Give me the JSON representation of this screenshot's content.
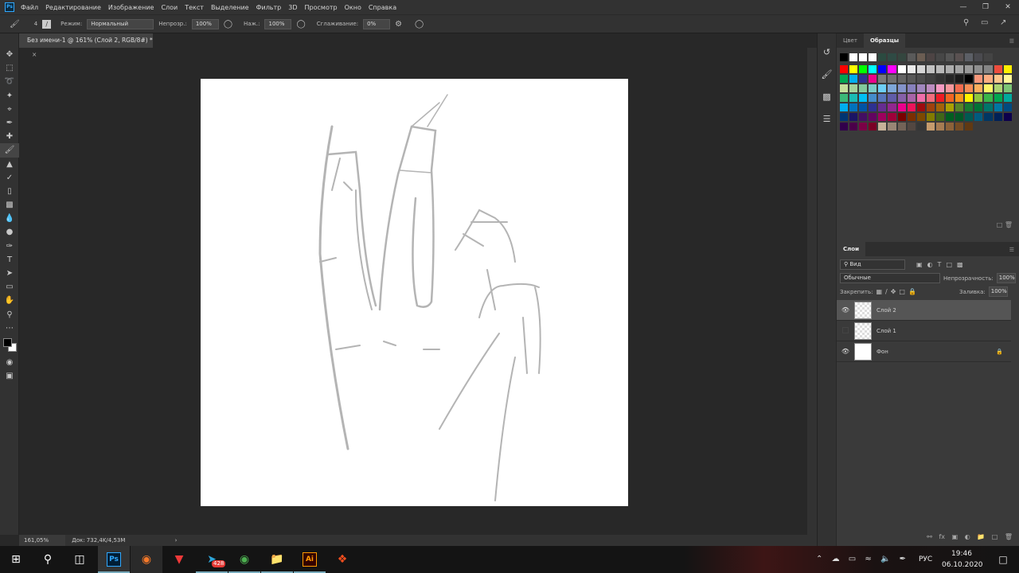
{
  "app": {
    "logo": "Ps",
    "menu": [
      "Файл",
      "Редактирование",
      "Изображение",
      "Слои",
      "Текст",
      "Выделение",
      "Фильтр",
      "3D",
      "Просмотр",
      "Окно",
      "Справка"
    ]
  },
  "options": {
    "brush_size": "4",
    "mode_label": "Режим:",
    "mode_value": "Нормальный",
    "opacity_label": "Непрозр.:",
    "opacity_value": "100%",
    "pressure_label": "Наж.:",
    "pressure_value": "100%",
    "smoothing_label": "Сглаживание:",
    "smoothing_value": "0%"
  },
  "document": {
    "tab_title": "Без имени-1 @ 161% (Слой 2, RGB/8#) *",
    "close": "×"
  },
  "status": {
    "zoom": "161,05%",
    "doc": "Док: 732,4K/4,53M",
    "arrow": "›"
  },
  "swatches_panel": {
    "tabs": [
      "Цвет",
      "Образцы"
    ],
    "active_tab": "Образцы",
    "rows": [
      [
        "#000000",
        "#ffffff",
        "#ffffff",
        "#ffffff",
        "#2b4a40",
        "#2f4a44",
        "#34463f",
        "#5a5a5a",
        "#6b5d52",
        "#4d4444",
        "#474747",
        "#555555",
        "#5a5151",
        "#5c5f66",
        "#4a4a4f",
        "#444444"
      ],
      [
        "#ff0000",
        "#ffff00",
        "#00ff00",
        "#00ffff",
        "#0000ff",
        "#ff00ff",
        "#ffffff",
        "#ebebeb",
        "#d6d6d6",
        "#c2c2c2",
        "#b8b8b8",
        "#adadad",
        "#a3a3a3",
        "#999999",
        "#8f8f8f",
        "#858585",
        "#ee4d3d",
        "#ffee00"
      ],
      [
        "#00a651",
        "#00aeef",
        "#2e3192",
        "#ec008c",
        "#7a7a7a",
        "#6f6f6f",
        "#646464",
        "#585858",
        "#4d4d4d",
        "#404040",
        "#333333",
        "#262626",
        "#1a1a1a",
        "#000000",
        "#f7977a",
        "#fbad82",
        "#fdc68c",
        "#fff799"
      ],
      [
        "#c4df9b",
        "#a3d39c",
        "#82ca9c",
        "#7accc8",
        "#6dcff6",
        "#7da7d9",
        "#8393ca",
        "#8781bd",
        "#a187be",
        "#bc8cbf",
        "#f49ac1",
        "#f6989d",
        "#f26c4f",
        "#f68e56",
        "#fbaf5d",
        "#fff568",
        "#acd373",
        "#7cc576"
      ],
      [
        "#3bb878",
        "#1abbb4",
        "#00bff3",
        "#448ccb",
        "#5674b9",
        "#605ca8",
        "#8560a8",
        "#a864a8",
        "#f06ea9",
        "#f26d7d",
        "#ed1c24",
        "#f26522",
        "#f7941d",
        "#fff200",
        "#8dc63f",
        "#39b54a",
        "#00a651",
        "#00a99d"
      ],
      [
        "#00aeef",
        "#0072bc",
        "#0054a6",
        "#2e3192",
        "#662d91",
        "#92278f",
        "#ec008c",
        "#ed145b",
        "#9e0b0f",
        "#a0410d",
        "#a36209",
        "#aba000",
        "#598527",
        "#197b30",
        "#007236",
        "#00746b",
        "#0076a3",
        "#004a80"
      ],
      [
        "#003471",
        "#1b1464",
        "#440e62",
        "#630460",
        "#9e005d",
        "#9e0039",
        "#790000",
        "#7b2e00",
        "#7d4900",
        "#827b00",
        "#406618",
        "#005e20",
        "#005826",
        "#005952",
        "#005b7f",
        "#003663",
        "#002157",
        "#0d004c"
      ],
      [
        "#32004b",
        "#4b0049",
        "#7b0046",
        "#7a0026",
        "#c7b299",
        "#998675",
        "#736357",
        "#534741",
        "#363636",
        "#c69c6d",
        "#a67c52",
        "#8c6239",
        "#754c24",
        "#603913"
      ]
    ]
  },
  "layers_panel": {
    "tab": "Слои",
    "filter": "Вид",
    "blend_mode": "Обычные",
    "opacity_label": "Непрозрачность:",
    "opacity_value": "100%",
    "lock_label": "Закрепить:",
    "fill_label": "Заливка:",
    "fill_value": "100%",
    "layers": [
      {
        "name": "Слой 2",
        "visible": true,
        "selected": true
      },
      {
        "name": "Слой 1",
        "visible": false,
        "selected": false
      },
      {
        "name": "Фон",
        "visible": true,
        "selected": false,
        "locked": true
      }
    ]
  },
  "taskbar": {
    "apps": [
      "Ps",
      "Blender",
      "Vivaldi",
      "Telegram",
      "Chrome",
      "Explorer",
      "Ai",
      "Figma"
    ],
    "telegram_badge": "428",
    "language": "РУС",
    "time": "19:46",
    "date": "06.10.2020"
  }
}
